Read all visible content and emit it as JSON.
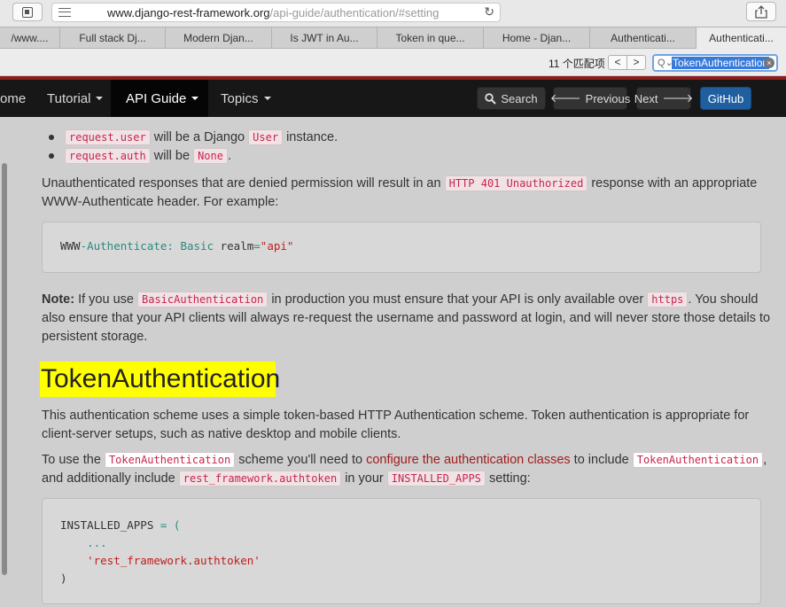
{
  "browser": {
    "url_main": "www.django-rest-framework.org",
    "url_path": "/api-guide/authentication/#setting",
    "tabs": [
      "/www....",
      "Full stack Dj...",
      "Modern Djan...",
      "Is JWT in Au...",
      "Token in que...",
      "Home - Djan...",
      "Authenticati...",
      "Authenticati..."
    ],
    "find": {
      "count": "11 个匹配项",
      "prev": "<",
      "next": ">",
      "query": "TokenAuthentication"
    }
  },
  "nav": {
    "home": "ome",
    "tutorial": "Tutorial",
    "api_guide": "API Guide",
    "topics": "Topics",
    "search": "Search",
    "previous": "Previous",
    "next": "Next",
    "github": "GitHub"
  },
  "content": {
    "b1_code": "request.user",
    "b1_text": "will be a Django",
    "b1_code2": "User",
    "b1_end": "instance.",
    "b2_code": "request.auth",
    "b2_text": "will be",
    "b2_code2": "None",
    "b2_end": ".",
    "p1_a": "Unauthenticated responses that are denied permission will result in an",
    "p1_code": "HTTP 401 Unauthorized",
    "p1_b": "response with an appropriate",
    "p1_c": "WWW-Authenticate header. For example:",
    "pre1": {
      "a": "WWW",
      "b": "-Authenticate:",
      "c": " Basic ",
      "d": "realm",
      "e": "=",
      "f": "\"api\""
    },
    "note_label": "Note:",
    "note_a": "If you use",
    "note_code": "BasicAuthentication",
    "note_b": "in production you must ensure that your API is only available over",
    "note_code2": "https",
    "note_c": ". You should",
    "note_d": "also ensure that your API clients will always re-request the username and password at login, and will never store those details to",
    "note_e": "persistent storage.",
    "heading": "TokenAuthentication",
    "p2_a": "This authentication scheme uses a simple token-based HTTP Authentication scheme. Token authentication is appropriate for",
    "p2_b": "client-server setups, such as native desktop and mobile clients.",
    "p3_a": "To use the",
    "p3_code": "TokenAuthentication",
    "p3_b": "scheme you'll need to",
    "p3_link": "configure the authentication classes",
    "p3_c": "to include",
    "p3_code2": "TokenAuthentication",
    "p3_d": ",",
    "p3_e": "and additionally include",
    "p3_code3": "rest_framework.authtoken",
    "p3_f": "in your",
    "p3_code4": "INSTALLED_APPS",
    "p3_g": "setting:",
    "pre2": {
      "l1a": "INSTALLED_APPS",
      "l1b": " = (",
      "l2": "    ...",
      "l3": "    'rest_framework.authtoken'",
      "l4": ")"
    }
  }
}
